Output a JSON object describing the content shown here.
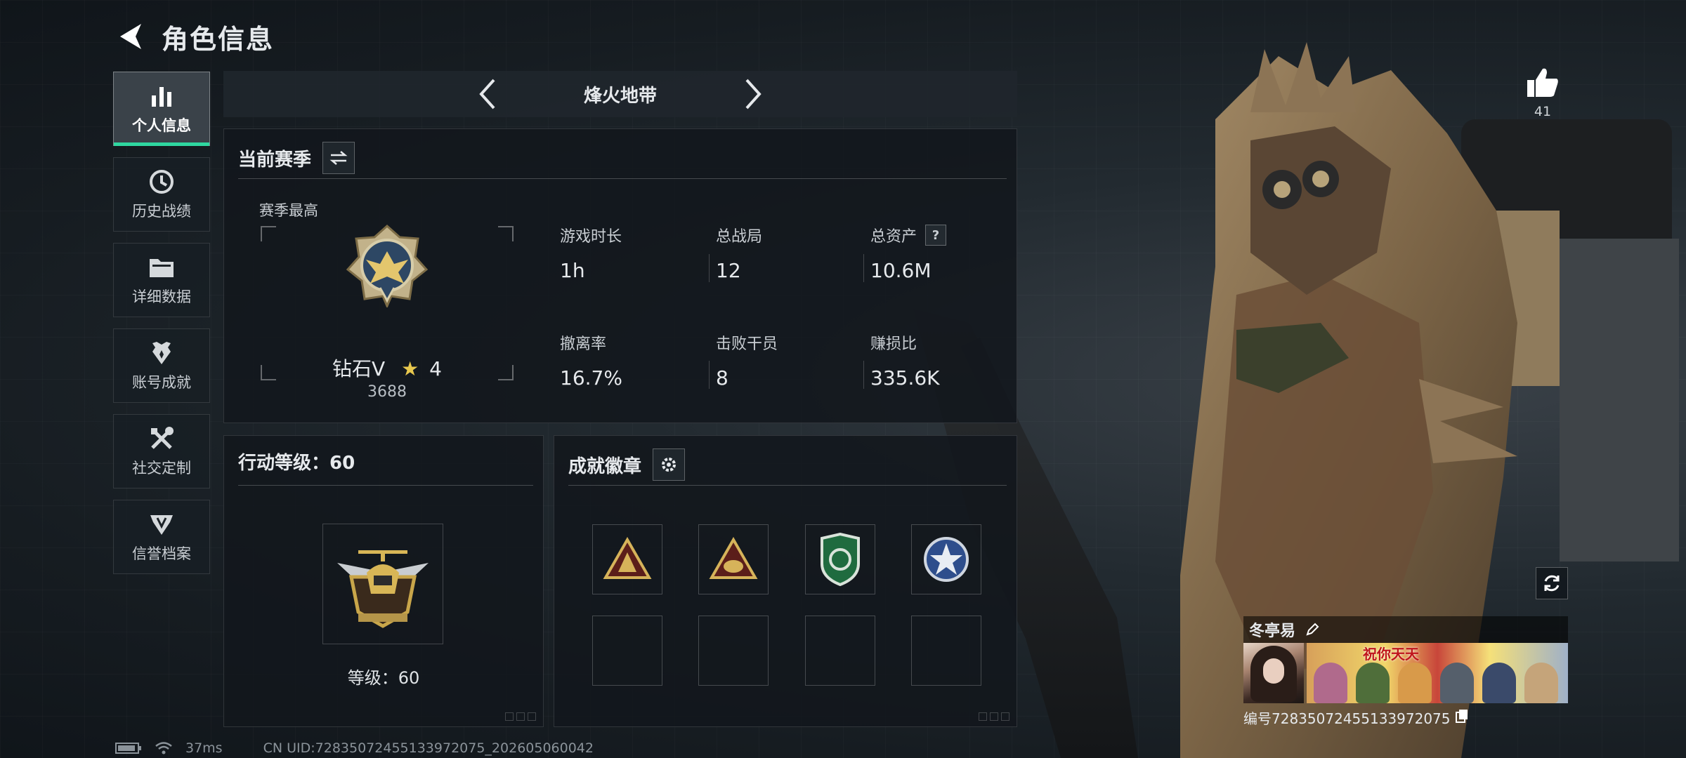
{
  "header": {
    "title": "角色信息"
  },
  "sidebar": {
    "items": [
      {
        "label": "个人信息",
        "icon": "bar-chart-icon",
        "active": true
      },
      {
        "label": "历史战绩",
        "icon": "clock-icon",
        "active": false
      },
      {
        "label": "详细数据",
        "icon": "folder-icon",
        "active": false
      },
      {
        "label": "账号成就",
        "icon": "achievement-icon",
        "active": false
      },
      {
        "label": "社交定制",
        "icon": "tools-icon",
        "active": false
      },
      {
        "label": "信誉档案",
        "icon": "credit-icon",
        "active": false
      }
    ]
  },
  "mode": {
    "title": "烽火地带"
  },
  "season": {
    "title": "当前赛季",
    "best_label": "赛季最高",
    "rank_name": "钻石V",
    "rank_stars": "4",
    "rank_points": "3688",
    "stats": [
      {
        "label": "游戏时长",
        "value": "1h"
      },
      {
        "label": "总战局",
        "value": "12"
      },
      {
        "label": "总资产",
        "value": "10.6M",
        "help": "?"
      },
      {
        "label": "撤离率",
        "value": "16.7%"
      },
      {
        "label": "击败干员",
        "value": "8"
      },
      {
        "label": "赚损比",
        "value": "335.6K"
      }
    ]
  },
  "level": {
    "title": "行动等级：60",
    "level_label": "等级：60"
  },
  "badges": {
    "title": "成就徽章",
    "filled": 4,
    "slots": 8
  },
  "likes": {
    "count": "41"
  },
  "profile": {
    "name": "冬亭易",
    "banner_text": "祝你天天",
    "uid_label": "编号7283507245513397​2075"
  },
  "status": {
    "ping": "37ms",
    "uid": "CN UID:7283507245513397​2075_202605060042"
  },
  "colors": {
    "accent": "#2fd7a0",
    "panel": "#12171c",
    "gold": "#c9a64a"
  }
}
